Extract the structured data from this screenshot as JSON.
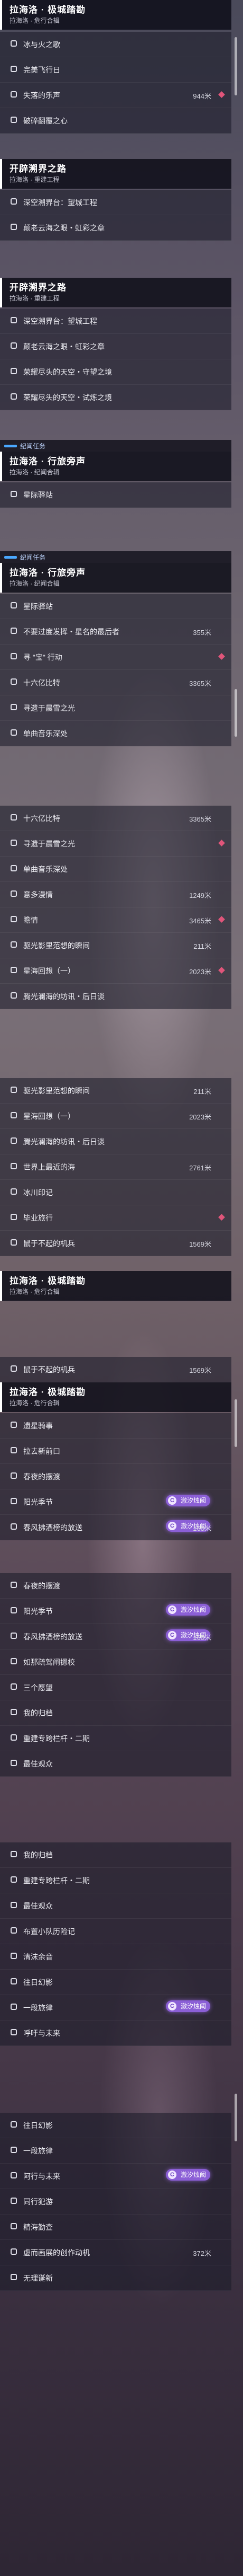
{
  "headers": [
    {
      "t1": "拉海洛 · 极城踏勘",
      "t2": ""
    },
    {
      "t1": "开辟溯界之路",
      "t2": "拉海洛 · 重建工程"
    },
    {
      "t1": "开辟溯界之路",
      "t2": "拉海洛 · 重建工程"
    },
    {
      "t1": "拉海洛 · 行旅旁声",
      "t2": "拉海洛 · 纪闻合辑"
    },
    {
      "t1": "拉海洛 · 行旅旁声",
      "t2": "拉海洛 · 纪闻合辑"
    },
    {
      "t1": "拉海洛 · 极城踏勘",
      "t2": "拉海洛 · 危行合辑"
    },
    {
      "t1": "拉海洛 · 极城踏勘",
      "t2": "拉海洛 · 危行合辑"
    }
  ],
  "tags": [
    {
      "label": "纪闻任务"
    },
    {
      "label": "纪闻任务"
    }
  ],
  "partial_texts": {
    "top_subtitle": "拉海洛 · 危行合辑",
    "before_jiyi": "世界上最近的海",
    "before_qizhao": "一段旅律"
  },
  "badge_label": "澈汐烛阈",
  "badge_icon": "C",
  "rows": [
    {
      "label": "冰与火之歌",
      "dist": "",
      "pin": false
    },
    {
      "label": "完美飞行日",
      "dist": "",
      "pin": false
    },
    {
      "label": "失落的乐声",
      "dist": "944米",
      "pin": true
    },
    {
      "label": "破碎翻覆之心",
      "dist": "",
      "pin": false
    },
    {
      "label": "深空溯界台：望城工程",
      "dist": "",
      "pin": false
    },
    {
      "label": "颠老云海之眼・虹彩之章",
      "dist": "",
      "pin": false
    },
    {
      "label": "深空溯界台：望城工程",
      "dist": "",
      "pin": false
    },
    {
      "label": "颠老云海之眼・虹彩之章",
      "dist": "",
      "pin": false
    },
    {
      "label": "荣耀尽头的天空・守望之境",
      "dist": "",
      "pin": false
    },
    {
      "label": "荣耀尽头的天空・试炼之境",
      "dist": "",
      "pin": false
    },
    {
      "label": "星际驿站",
      "dist": "",
      "pin": false
    },
    {
      "label": "星际驿站",
      "dist": "",
      "pin": false
    },
    {
      "label": "不要过度发挥・星名的最后者",
      "dist": "355米",
      "pin": false
    },
    {
      "label": "寻 \"宝\" 行动",
      "dist": "",
      "pin": true
    },
    {
      "label": "十六亿比特",
      "dist": "3365米",
      "pin": false
    },
    {
      "label": "寻遗于晨雪之光",
      "dist": "",
      "pin": false
    },
    {
      "label": "单曲音乐深处",
      "dist": "",
      "pin": false
    },
    {
      "label": "十六亿比特",
      "dist": "3365米",
      "pin": false
    },
    {
      "label": "寻遗于晨雪之光",
      "dist": "",
      "pin": true
    },
    {
      "label": "单曲音乐深处",
      "dist": "",
      "pin": false
    },
    {
      "label": "意多漫情",
      "dist": "1249米",
      "pin": false
    },
    {
      "label": "瞻情",
      "dist": "3465米",
      "pin": true
    },
    {
      "label": "驱光影里范想的瞬间",
      "dist": "211米",
      "pin": false
    },
    {
      "label": "星海回想（一）",
      "dist": "2023米",
      "pin": true
    },
    {
      "label": "腾光澜海的坊讯・后日谈",
      "dist": "",
      "pin": false
    },
    {
      "label": "驱光影里范想的瞬间",
      "dist": "211米",
      "pin": false
    },
    {
      "label": "星海回想（一）",
      "dist": "2023米",
      "pin": false
    },
    {
      "label": "腾光澜海的坊讯・后日谈",
      "dist": "",
      "pin": false
    },
    {
      "label": "世界上最近的海",
      "dist": "2761米",
      "pin": false
    },
    {
      "label": "冰川印记",
      "dist": "",
      "pin": false
    },
    {
      "label": "毕业旅行",
      "dist": "",
      "pin": true
    },
    {
      "label": "鼠于不起的机兵",
      "dist": "1569米",
      "pin": false
    },
    {
      "label": "鼠于不起的机兵",
      "dist": "1569米",
      "pin": false
    },
    {
      "label": "遗星骑事",
      "dist": "",
      "pin": false
    },
    {
      "label": "拉去新前曰",
      "dist": "",
      "pin": false
    },
    {
      "label": "春夜的摆渡",
      "dist": "",
      "pin": false
    },
    {
      "label": "阳光季节",
      "dist": "",
      "pin": false
    },
    {
      "label": "春风拂酒榜的放送",
      "dist": "168米",
      "pin": false
    },
    {
      "label": "春夜的摆渡",
      "dist": "",
      "pin": false
    },
    {
      "label": "阳光季节",
      "dist": "",
      "pin": false
    },
    {
      "label": "春风拂酒榜的放送",
      "dist": "168米",
      "pin": false
    },
    {
      "label": "如那疏驾闸摁校",
      "dist": "",
      "pin": false
    },
    {
      "label": "三个愿望",
      "dist": "",
      "pin": false
    },
    {
      "label": "我的归档",
      "dist": "",
      "pin": false
    },
    {
      "label": "重建专跨栏杆・二期",
      "dist": "",
      "pin": false
    },
    {
      "label": "最佳观众",
      "dist": "",
      "pin": false
    },
    {
      "label": "我的归档",
      "dist": "",
      "pin": false
    },
    {
      "label": "重建专跨栏杆・二期",
      "dist": "",
      "pin": false
    },
    {
      "label": "最佳观众",
      "dist": "",
      "pin": false
    },
    {
      "label": "布置小队历险记",
      "dist": "",
      "pin": false
    },
    {
      "label": "清沫余音",
      "dist": "",
      "pin": false
    },
    {
      "label": "往日幻影",
      "dist": "",
      "pin": false
    },
    {
      "label": "一段旅律",
      "dist": "",
      "pin": false
    },
    {
      "label": "呼吁与未来",
      "dist": "",
      "pin": false
    },
    {
      "label": "往日幻影",
      "dist": "",
      "pin": false
    },
    {
      "label": "一段旅律",
      "dist": "",
      "pin": false
    },
    {
      "label": "阿行与未来",
      "dist": "",
      "pin": false
    },
    {
      "label": "同行犯游",
      "dist": "",
      "pin": false
    },
    {
      "label": "精海勤查",
      "dist": "",
      "pin": false
    },
    {
      "label": "虚而画展的创作动机",
      "dist": "372米",
      "pin": false
    },
    {
      "label": "无理诞新",
      "dist": "",
      "pin": false
    }
  ]
}
